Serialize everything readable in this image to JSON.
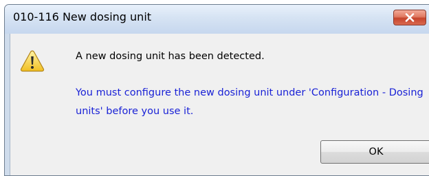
{
  "window": {
    "title": "010-116 New dosing unit",
    "close_icon": "close-icon"
  },
  "dialog": {
    "icon": "warning-icon",
    "message": "A new dosing unit has been detected.",
    "info": "You must configure the new dosing unit under 'Configuration - Dosing units' before you use it.",
    "info_color": "#1a22d6",
    "ok_label": "OK"
  }
}
